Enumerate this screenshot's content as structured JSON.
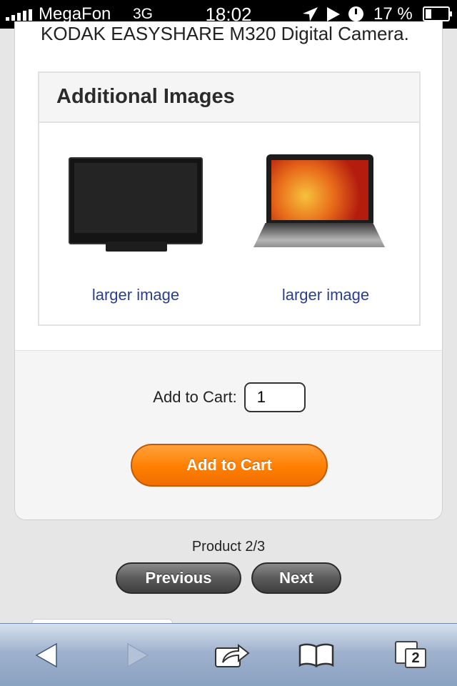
{
  "status_bar": {
    "carrier": "MegaFon",
    "network": "3G",
    "time": "18:02",
    "battery": "17 %"
  },
  "product": {
    "title": "KODAK EASYSHARE M320 Digital Camera."
  },
  "additional_images": {
    "heading": "Additional Images",
    "items": [
      {
        "icon": "tv-image",
        "link": "larger image"
      },
      {
        "icon": "laptop-image",
        "link": "larger image"
      }
    ]
  },
  "cart": {
    "qty_label": "Add to Cart:",
    "qty_value": "1",
    "button_label": "Add to Cart",
    "accent_color": "#ff8400"
  },
  "pager": {
    "text": "Product 2/3",
    "prev_label": "Previous",
    "next_label": "Next"
  },
  "toolbar": {
    "tabs_count": "2",
    "icons": [
      "back-icon",
      "forward-icon",
      "share-icon",
      "bookmarks-icon",
      "tabs-icon"
    ]
  }
}
